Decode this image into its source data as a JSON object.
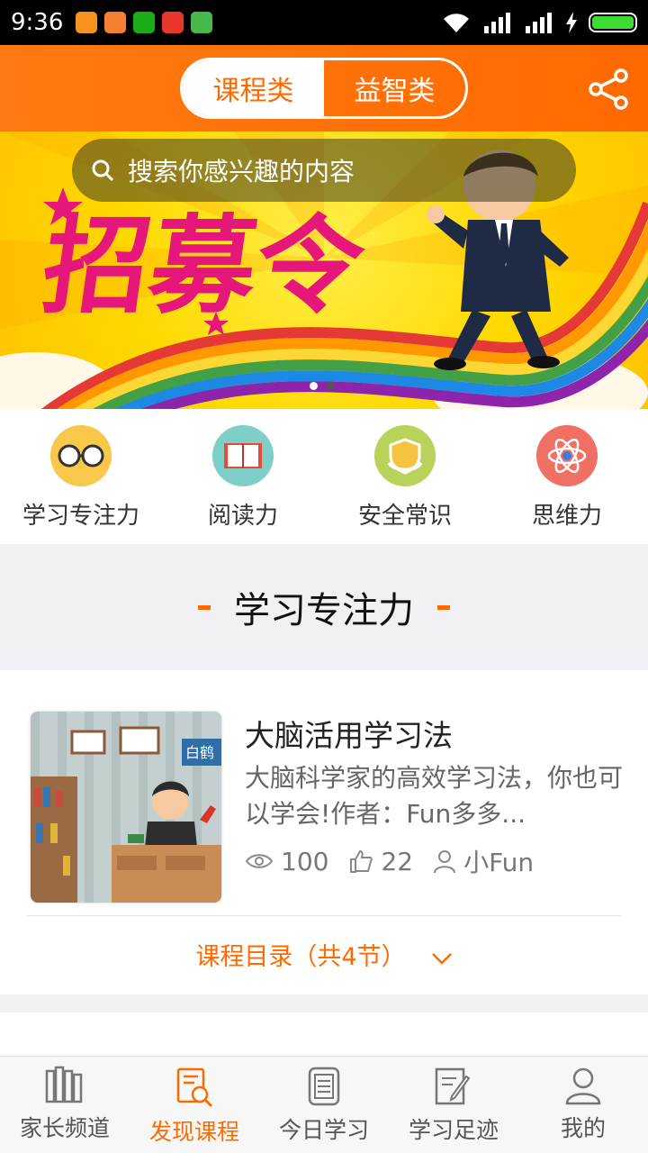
{
  "status_bar": {
    "time": "9:36"
  },
  "header": {
    "tabs": [
      {
        "label": "课程类",
        "active": true
      },
      {
        "label": "益智类",
        "active": false
      }
    ],
    "accent": "#ff6a00"
  },
  "banner": {
    "search_placeholder": "搜索你感兴趣的内容",
    "headline": "招募令"
  },
  "categories": [
    {
      "label": "学习专注力",
      "icon": "glasses-icon"
    },
    {
      "label": "阅读力",
      "icon": "book-icon"
    },
    {
      "label": "安全常识",
      "icon": "shield-icon"
    },
    {
      "label": "思维力",
      "icon": "atom-icon"
    }
  ],
  "section": {
    "title": "学习专注力"
  },
  "course": {
    "title": "大脑活用学习法",
    "description": "大脑科学家的高效学习法，你也可以学会!作者：Fun多多...",
    "views": "100",
    "likes": "22",
    "author": "小Fun",
    "thumb_sign": "白鹤",
    "catalog_label": "课程目录（共4节）"
  },
  "bottom_nav": [
    {
      "label": "家长频道",
      "icon": "books-icon",
      "active": false
    },
    {
      "label": "发现课程",
      "icon": "discover-icon",
      "active": true
    },
    {
      "label": "今日学习",
      "icon": "notebook-icon",
      "active": false
    },
    {
      "label": "学习足迹",
      "icon": "edit-note-icon",
      "active": false
    },
    {
      "label": "我的",
      "icon": "user-icon",
      "active": false
    }
  ]
}
